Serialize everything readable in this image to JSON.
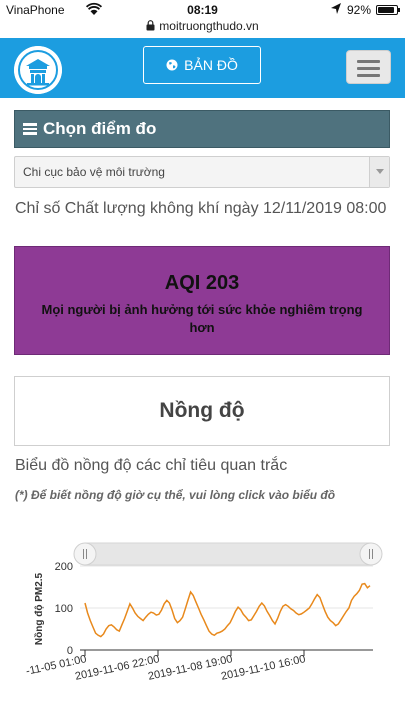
{
  "status_bar": {
    "carrier": "VinaPhone",
    "time": "08:19",
    "battery": "92%"
  },
  "browser": {
    "url": "moitruongthudo.vn"
  },
  "header": {
    "map_button_label": "BẢN ĐỒ"
  },
  "station_picker": {
    "title": "Chọn điểm đo",
    "selected": "Chi cục bảo vệ môi trường"
  },
  "aqi": {
    "heading": "Chỉ số Chất lượng không khí ngày 12/11/2019 08:00",
    "value_label": "AQI 203",
    "description": "Mọi người bị ảnh hưởng tới sức khỏe nghiêm trọng hơn",
    "color": "#8e3a95"
  },
  "concentration": {
    "title": "Nồng độ"
  },
  "chart_section": {
    "title": "Biểu đồ nồng độ các chỉ tiêu quan trắc",
    "note": "(*) Để biết nồng độ giờ cụ thể, vui lòng click vào biểu đồ"
  },
  "chart_data": {
    "type": "line",
    "ylabel": "Nồng độ PM2.5",
    "ylim": [
      0,
      200
    ],
    "yticks": [
      "0",
      "100",
      "200"
    ],
    "xticks": [
      "-11-05 01:00",
      "2019-11-06 22:00",
      "2019-11-08 19:00",
      "2019-11-10 16:00"
    ],
    "xlim": [
      "2019-11-05 01:00",
      "2019-11-12 08:00"
    ],
    "line_color": "#e8891c",
    "series": [
      {
        "values": [
          112,
          88,
          70,
          55,
          40,
          35,
          32,
          38,
          50,
          58,
          60,
          55,
          48,
          45,
          60,
          75,
          92,
          110,
          100,
          88,
          80,
          75,
          70,
          78,
          85,
          90,
          88,
          83,
          85,
          95,
          110,
          118,
          112,
          95,
          75,
          65,
          70,
          78,
          98,
          118,
          138,
          130,
          115,
          100,
          85,
          72,
          58,
          45,
          38,
          35,
          40,
          42,
          45,
          50,
          58,
          65,
          78,
          92,
          102,
          96,
          85,
          78,
          70,
          72,
          82,
          92,
          104,
          112,
          105,
          92,
          82,
          70,
          62,
          75,
          92,
          104,
          108,
          104,
          98,
          94,
          88,
          84,
          86,
          90,
          95,
          100,
          110,
          122,
          132,
          125,
          108,
          92,
          78,
          70,
          65,
          58,
          62,
          72,
          82,
          92,
          100,
          118,
          128,
          134,
          142,
          157,
          158,
          148,
          153
        ]
      }
    ]
  }
}
